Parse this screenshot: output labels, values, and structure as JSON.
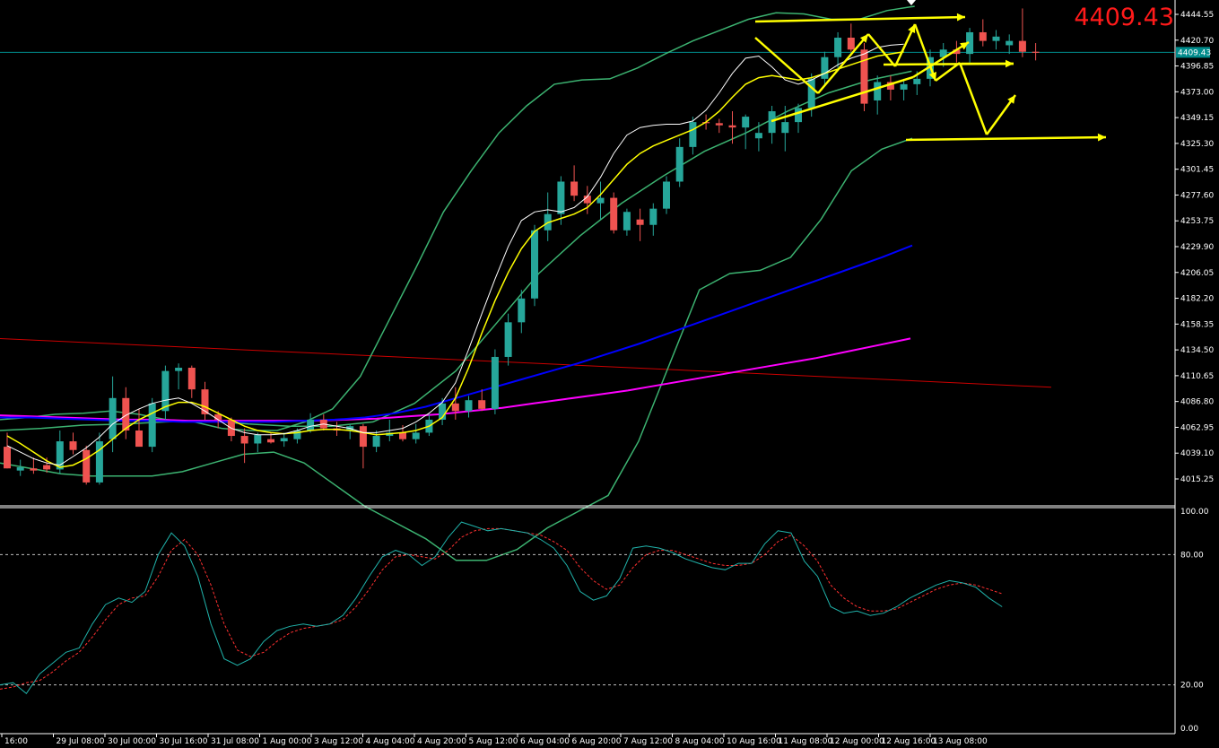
{
  "header": {
    "current_price": "4409.43"
  },
  "colors": {
    "background": "#000000",
    "bull": "#26a69a",
    "bear": "#ef5350",
    "ma_fast": "#ffffff",
    "ma_mid": "#ffff00",
    "ma_slow": "#0000ff",
    "ma_long": "#ff00ff",
    "bollinger": "#3cb371",
    "trend_line": "#cc0000",
    "price_line": "#008b8b",
    "annotation": "#ffff00",
    "stoch_main": "#20b2aa",
    "stoch_signal": "#ff3030"
  },
  "chart_data": [
    {
      "type": "candlestick",
      "ylim": [
        4000,
        4460
      ],
      "price_line": 4409.43,
      "price_tag": "4409.43",
      "y_ticks": [
        "4444.55",
        "4420.70",
        "4396.85",
        "4373.00",
        "4349.15",
        "4325.30",
        "4301.45",
        "4277.60",
        "4253.75",
        "4229.90",
        "4206.05",
        "4182.20",
        "4158.35",
        "4134.50",
        "4110.65",
        "4086.80",
        "4062.95",
        "4039.10",
        "4015.25"
      ],
      "x_ticks": [
        "16:00",
        "29 Jul 08:00",
        "30 Jul 00:00",
        "30 Jul 16:00",
        "31 Jul 08:00",
        "1 Aug 00:00",
        "3 Aug 12:00",
        "4 Aug 04:00",
        "4 Aug 20:00",
        "5 Aug 12:00",
        "6 Aug 04:00",
        "6 Aug 20:00",
        "7 Aug 12:00",
        "8 Aug 04:00",
        "10 Aug 16:00",
        "11 Aug 08:00",
        "12 Aug 00:00",
        "12 Aug 16:00",
        "13 Aug 08:00"
      ],
      "candles": [
        [
          4045,
          4058,
          4025,
          4025
        ],
        [
          4023,
          4033,
          4018,
          4026
        ],
        [
          4025,
          4035,
          4020,
          4023
        ],
        [
          4028,
          4035,
          4021,
          4024
        ],
        [
          4024,
          4060,
          4020,
          4050
        ],
        [
          4050,
          4058,
          4038,
          4042
        ],
        [
          4042,
          4046,
          4010,
          4012
        ],
        [
          4012,
          4058,
          4010,
          4050
        ],
        [
          4052,
          4110,
          4040,
          4090
        ],
        [
          4090,
          4100,
          4052,
          4060
        ],
        [
          4060,
          4080,
          4052,
          4045
        ],
        [
          4045,
          4090,
          4040,
          4085
        ],
        [
          4078,
          4120,
          4070,
          4115
        ],
        [
          4115,
          4122,
          4098,
          4118
        ],
        [
          4118,
          4120,
          4090,
          4098
        ],
        [
          4098,
          4105,
          4070,
          4075
        ],
        [
          4075,
          4078,
          4062,
          4070
        ],
        [
          4070,
          4072,
          4050,
          4055
        ],
        [
          4055,
          4062,
          4030,
          4048
        ],
        [
          4048,
          4058,
          4040,
          4056
        ],
        [
          4052,
          4058,
          4048,
          4049
        ],
        [
          4050,
          4058,
          4045,
          4053
        ],
        [
          4052,
          4062,
          4048,
          4060
        ],
        [
          4060,
          4076,
          4058,
          4070
        ],
        [
          4070,
          4075,
          4060,
          4062
        ],
        [
          4062,
          4068,
          4055,
          4060
        ],
        [
          4060,
          4066,
          4052,
          4064
        ],
        [
          4064,
          4066,
          4025,
          4045
        ],
        [
          4045,
          4060,
          4040,
          4055
        ],
        [
          4055,
          4070,
          4050,
          4058
        ],
        [
          4058,
          4065,
          4050,
          4052
        ],
        [
          4052,
          4066,
          4048,
          4058
        ],
        [
          4058,
          4075,
          4055,
          4070
        ],
        [
          4070,
          4090,
          4065,
          4085
        ],
        [
          4085,
          4100,
          4070,
          4078
        ],
        [
          4078,
          4092,
          4072,
          4088
        ],
        [
          4088,
          4098,
          4078,
          4080
        ],
        [
          4080,
          4135,
          4075,
          4128
        ],
        [
          4128,
          4168,
          4120,
          4160
        ],
        [
          4160,
          4190,
          4150,
          4182
        ],
        [
          4182,
          4250,
          4175,
          4245
        ],
        [
          4245,
          4280,
          4235,
          4260
        ],
        [
          4260,
          4295,
          4250,
          4290
        ],
        [
          4290,
          4305,
          4272,
          4277
        ],
        [
          4277,
          4286,
          4260,
          4270
        ],
        [
          4270,
          4290,
          4255,
          4275
        ],
        [
          4275,
          4280,
          4242,
          4245
        ],
        [
          4245,
          4265,
          4240,
          4262
        ],
        [
          4255,
          4265,
          4235,
          4250
        ],
        [
          4250,
          4270,
          4240,
          4265
        ],
        [
          4265,
          4295,
          4260,
          4290
        ],
        [
          4290,
          4330,
          4285,
          4322
        ],
        [
          4322,
          4350,
          4315,
          4345
        ],
        [
          4345,
          4352,
          4338,
          4344
        ],
        [
          4344,
          4348,
          4335,
          4342
        ],
        [
          4342,
          4355,
          4325,
          4340
        ],
        [
          4340,
          4352,
          4320,
          4350
        ],
        [
          4330,
          4345,
          4318,
          4335
        ],
        [
          4335,
          4360,
          4325,
          4355
        ],
        [
          4335,
          4360,
          4318,
          4345
        ],
        [
          4345,
          4362,
          4335,
          4358
        ],
        [
          4358,
          4390,
          4350,
          4385
        ],
        [
          4385,
          4410,
          4378,
          4405
        ],
        [
          4405,
          4428,
          4395,
          4423
        ],
        [
          4423,
          4436,
          4410,
          4412
        ],
        [
          4412,
          4418,
          4355,
          4362
        ],
        [
          4365,
          4388,
          4352,
          4382
        ],
        [
          4382,
          4388,
          4365,
          4375
        ],
        [
          4375,
          4385,
          4365,
          4380
        ],
        [
          4380,
          4392,
          4370,
          4385
        ],
        [
          4385,
          4412,
          4378,
          4405
        ],
        [
          4405,
          4418,
          4396,
          4412
        ],
        [
          4412,
          4420,
          4400,
          4408
        ],
        [
          4408,
          4432,
          4400,
          4428
        ],
        [
          4428,
          4440,
          4415,
          4420
        ],
        [
          4420,
          4430,
          4412,
          4424
        ],
        [
          4416,
          4426,
          4408,
          4420
        ],
        [
          4420,
          4450,
          4405,
          4410
        ],
        [
          4410,
          4418,
          4402,
          4409
        ]
      ],
      "bollinger_upper": [
        4070,
        4072,
        4075,
        4076,
        4078,
        4075,
        4070,
        4068,
        4062,
        4060,
        4060,
        4068,
        4080,
        4110,
        4160,
        4210,
        4262,
        4300,
        4335,
        4360,
        4380,
        4384,
        4385,
        4395,
        4408,
        4420,
        4430,
        4440,
        4446,
        4445,
        4440,
        4440,
        4448,
        4452
      ],
      "bollinger_middle": [
        4060,
        4062,
        4065,
        4066,
        4068,
        4069,
        4066,
        4064,
        4064,
        4068,
        4085,
        4115,
        4160,
        4205,
        4240,
        4270,
        4295,
        4318,
        4335,
        4355,
        4372,
        4384,
        4392
      ],
      "bollinger_lower": [
        4030,
        4025,
        4020,
        4018,
        4018,
        4018,
        4022,
        4030,
        4038,
        4040,
        4030,
        4010,
        3990,
        3975,
        3960,
        3940,
        3940,
        3950,
        3970,
        3985,
        4000,
        4050,
        4120,
        4190,
        4205,
        4208,
        4220,
        4255,
        4300,
        4320,
        4330
      ],
      "ma_fast": [
        4046,
        4040,
        4034,
        4030,
        4028,
        4036,
        4044,
        4054,
        4066,
        4074,
        4080,
        4085,
        4088,
        4090,
        4085,
        4078,
        4070,
        4062,
        4058,
        4056,
        4056,
        4057,
        4060,
        4064,
        4066,
        4064,
        4062,
        4058,
        4058,
        4060,
        4062,
        4068,
        4076,
        4086,
        4104,
        4135,
        4168,
        4200,
        4230,
        4254,
        4262,
        4264,
        4262,
        4266,
        4276,
        4294,
        4316,
        4333,
        4340,
        4342,
        4343,
        4343,
        4346,
        4356,
        4372,
        4390,
        4404,
        4406,
        4396,
        4384,
        4380,
        4384,
        4390,
        4398,
        4404,
        4408,
        4414,
        4416,
        4417
      ],
      "ma_mid": [
        4055,
        4048,
        4040,
        4032,
        4026,
        4028,
        4034,
        4042,
        4052,
        4062,
        4070,
        4076,
        4082,
        4086,
        4086,
        4082,
        4076,
        4070,
        4064,
        4060,
        4058,
        4057,
        4058,
        4060,
        4061,
        4061,
        4060,
        4058,
        4056,
        4057,
        4058,
        4060,
        4064,
        4072,
        4090,
        4118,
        4150,
        4180,
        4206,
        4228,
        4244,
        4252,
        4256,
        4260,
        4266,
        4278,
        4292,
        4306,
        4316,
        4323,
        4328,
        4333,
        4338,
        4345,
        4355,
        4368,
        4380,
        4386,
        4388,
        4386,
        4384,
        4386,
        4390,
        4394,
        4398,
        4402,
        4406,
        4408,
        4410
      ],
      "ma_slow": [
        4072,
        4072,
        4071,
        4070,
        4069,
        4069,
        4068,
        4068,
        4068,
        4068,
        4069,
        4070,
        4072,
        4076,
        4082,
        4090,
        4098,
        4106,
        4114,
        4122,
        4131,
        4140,
        4150,
        4160,
        4170,
        4180,
        4190,
        4200,
        4210,
        4220,
        4231
      ],
      "ma_long": [
        4074,
        4073,
        4072,
        4071,
        4070,
        4070,
        4069,
        4069,
        4069,
        4069,
        4069,
        4070,
        4071,
        4073,
        4075,
        4078,
        4081,
        4085,
        4089,
        4093,
        4097,
        4102,
        4107,
        4112,
        4117,
        4122,
        4127,
        4133,
        4139,
        4145
      ],
      "trend_line_start": 4145,
      "trend_line_end": 4100,
      "stochastic": {
        "ylim": [
          0,
          100
        ],
        "y_ticks": [
          "100.00",
          "80.00",
          "20.00",
          "0.00"
        ],
        "levels": [
          80,
          20
        ],
        "main": [
          20,
          21,
          16,
          25,
          30,
          35,
          37,
          48,
          57,
          60,
          58,
          63,
          80,
          90,
          84,
          70,
          48,
          32,
          29,
          32,
          40,
          45,
          47,
          48,
          47,
          48,
          52,
          60,
          70,
          79,
          82,
          80,
          75,
          79,
          88,
          95,
          93,
          91,
          92,
          91,
          90,
          87,
          83,
          75,
          63,
          59,
          61,
          69,
          83,
          84,
          83,
          81,
          78,
          76,
          74,
          73,
          76,
          76,
          85,
          91,
          90,
          77,
          70,
          56,
          53,
          54,
          52,
          53,
          56,
          60,
          63,
          66,
          68,
          67,
          65,
          60,
          56
        ],
        "signal": [
          18,
          19,
          21,
          22,
          26,
          31,
          35,
          42,
          50,
          57,
          60,
          61,
          70,
          82,
          87,
          80,
          66,
          48,
          36,
          33,
          35,
          40,
          44,
          46,
          47,
          48,
          50,
          56,
          64,
          73,
          79,
          80,
          79,
          78,
          82,
          88,
          91,
          92,
          92,
          91,
          90,
          89,
          86,
          82,
          74,
          68,
          64,
          66,
          74,
          80,
          82,
          82,
          80,
          78,
          76,
          75,
          75,
          76,
          80,
          86,
          89,
          84,
          77,
          66,
          60,
          56,
          54,
          54,
          55,
          58,
          61,
          64,
          66,
          67,
          66,
          64,
          62
        ]
      }
    }
  ]
}
